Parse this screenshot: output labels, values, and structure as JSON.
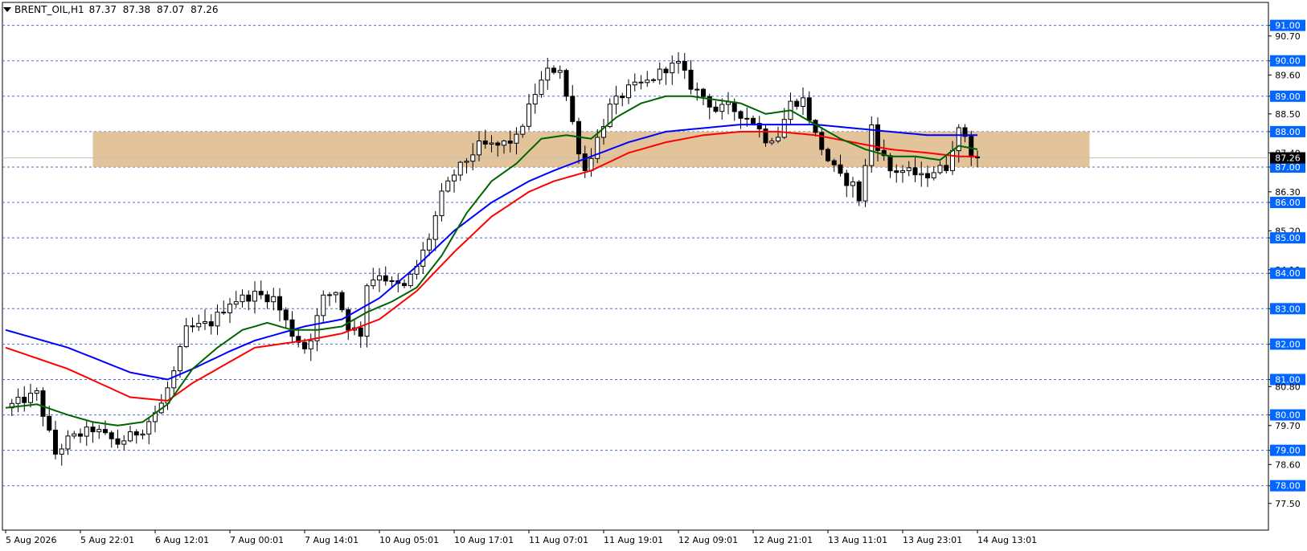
{
  "header": {
    "symbol": "BRENT_OIL,H1",
    "open": "87.37",
    "high": "87.38",
    "low": "87.07",
    "close": "87.26"
  },
  "colors": {
    "background": "#ffffff",
    "grid": "#4a6bc9",
    "zone": "#deb887",
    "ema_fast": "#006400",
    "ema_mid": "#ff0000",
    "ema_slow": "#0000ff",
    "candle": "#000000",
    "level_box": "#0066ff",
    "price_box": "#000000"
  },
  "chart_data": {
    "type": "candlestick",
    "symbol": "BRENT_OIL",
    "timeframe": "H1",
    "ylim": [
      77.2,
      91.4
    ],
    "y_ticks": [
      {
        "value": 91.0,
        "label": "91.00",
        "highlight": true
      },
      {
        "value": 90.7,
        "label": "90.70",
        "highlight": false
      },
      {
        "value": 90.0,
        "label": "90.00",
        "highlight": true
      },
      {
        "value": 89.6,
        "label": "89.60",
        "highlight": false
      },
      {
        "value": 89.0,
        "label": "89.00",
        "highlight": true
      },
      {
        "value": 88.5,
        "label": "88.50",
        "highlight": false
      },
      {
        "value": 88.0,
        "label": "88.00",
        "highlight": true
      },
      {
        "value": 87.4,
        "label": "87.40",
        "highlight": false
      },
      {
        "value": 87.0,
        "label": "87.00",
        "highlight": true
      },
      {
        "value": 86.3,
        "label": "86.30",
        "highlight": false
      },
      {
        "value": 86.0,
        "label": "86.00",
        "highlight": true
      },
      {
        "value": 85.2,
        "label": "85.20",
        "highlight": false
      },
      {
        "value": 85.0,
        "label": "85.00",
        "highlight": true
      },
      {
        "value": 84.1,
        "label": "84.10",
        "highlight": false
      },
      {
        "value": 84.0,
        "label": "84.00",
        "highlight": true
      },
      {
        "value": 83.0,
        "label": "83.00",
        "highlight": true
      },
      {
        "value": 82.0,
        "label": "82.00",
        "highlight": true
      },
      {
        "value": 81.0,
        "label": "81.00",
        "highlight": true
      },
      {
        "value": 80.8,
        "label": "80.80",
        "highlight": false
      },
      {
        "value": 80.0,
        "label": "80.00",
        "highlight": true
      },
      {
        "value": 79.7,
        "label": "79.70",
        "highlight": false
      },
      {
        "value": 79.0,
        "label": "79.00",
        "highlight": true
      },
      {
        "value": 78.6,
        "label": "78.60",
        "highlight": false
      },
      {
        "value": 78.0,
        "label": "78.00",
        "highlight": true
      },
      {
        "value": 77.5,
        "label": "77.50",
        "highlight": false
      }
    ],
    "grid_levels": [
      91,
      90,
      89,
      88,
      87,
      86,
      85,
      84,
      83,
      82,
      81,
      80,
      79,
      78
    ],
    "current_price": 87.26,
    "current_price_label": "87.26",
    "zone": {
      "from": 87.0,
      "to": 88.0,
      "start_bar": 14,
      "end_bar": 174
    },
    "x_ticks": [
      {
        "bar": 0,
        "label": "5 Aug 2026"
      },
      {
        "bar": 12,
        "label": "5 Aug 22:01"
      },
      {
        "bar": 24,
        "label": "6 Aug 12:01"
      },
      {
        "bar": 36,
        "label": "7 Aug 00:01"
      },
      {
        "bar": 48,
        "label": "7 Aug 14:01"
      },
      {
        "bar": 60,
        "label": "10 Aug 05:01"
      },
      {
        "bar": 72,
        "label": "10 Aug 17:01"
      },
      {
        "bar": 84,
        "label": "11 Aug 07:01"
      },
      {
        "bar": 96,
        "label": "11 Aug 19:01"
      },
      {
        "bar": 108,
        "label": "12 Aug 09:01"
      },
      {
        "bar": 120,
        "label": "12 Aug 21:01"
      },
      {
        "bar": 132,
        "label": "13 Aug 11:01"
      },
      {
        "bar": 144,
        "label": "13 Aug 23:01"
      },
      {
        "bar": 156,
        "label": "14 Aug 13:01"
      }
    ],
    "bar_count": 156,
    "close_anchors": [
      [
        0,
        80.2
      ],
      [
        5,
        80.6
      ],
      [
        8,
        78.9
      ],
      [
        10,
        79.3
      ],
      [
        14,
        79.6
      ],
      [
        18,
        79.2
      ],
      [
        22,
        79.6
      ],
      [
        25,
        80.3
      ],
      [
        27,
        81.2
      ],
      [
        29,
        82.4
      ],
      [
        33,
        82.6
      ],
      [
        36,
        83.2
      ],
      [
        40,
        83.4
      ],
      [
        43,
        83.3
      ],
      [
        46,
        82.3
      ],
      [
        48,
        81.9
      ],
      [
        49,
        82.2
      ],
      [
        51,
        83.3
      ],
      [
        53,
        83.5
      ],
      [
        55,
        82.5
      ],
      [
        57,
        82.3
      ],
      [
        58,
        83.7
      ],
      [
        60,
        84.0
      ],
      [
        62,
        83.7
      ],
      [
        64,
        83.6
      ],
      [
        66,
        84.2
      ],
      [
        68,
        85.0
      ],
      [
        70,
        86.2
      ],
      [
        72,
        86.8
      ],
      [
        74,
        87.2
      ],
      [
        76,
        87.6
      ],
      [
        79,
        87.6
      ],
      [
        82,
        87.8
      ],
      [
        85,
        89.1
      ],
      [
        87,
        89.7
      ],
      [
        89,
        89.8
      ],
      [
        90,
        89.0
      ],
      [
        92,
        87.5
      ],
      [
        93,
        86.9
      ],
      [
        95,
        87.8
      ],
      [
        97,
        88.7
      ],
      [
        100,
        89.2
      ],
      [
        103,
        89.4
      ],
      [
        106,
        89.8
      ],
      [
        108,
        89.9
      ],
      [
        110,
        89.3
      ],
      [
        112,
        89.0
      ],
      [
        114,
        88.6
      ],
      [
        116,
        88.7
      ],
      [
        118,
        88.5
      ],
      [
        120,
        88.3
      ],
      [
        122,
        87.8
      ],
      [
        124,
        87.9
      ],
      [
        126,
        88.8
      ],
      [
        128,
        88.9
      ],
      [
        130,
        87.9
      ],
      [
        132,
        87.2
      ],
      [
        134,
        86.7
      ],
      [
        136,
        86.5
      ],
      [
        137,
        86.1
      ],
      [
        138,
        87.0
      ],
      [
        139,
        88.2
      ],
      [
        140,
        87.6
      ],
      [
        142,
        86.9
      ],
      [
        144,
        86.9
      ],
      [
        146,
        86.8
      ],
      [
        147,
        86.7
      ],
      [
        149,
        86.9
      ],
      [
        151,
        87.0
      ],
      [
        152,
        87.6
      ],
      [
        153,
        88.0
      ],
      [
        154,
        87.9
      ],
      [
        155,
        87.37
      ],
      [
        156,
        87.26
      ]
    ],
    "ema_fast_anchors": [
      [
        0,
        80.2
      ],
      [
        5,
        80.3
      ],
      [
        10,
        80.0
      ],
      [
        14,
        79.8
      ],
      [
        18,
        79.7
      ],
      [
        22,
        79.8
      ],
      [
        26,
        80.3
      ],
      [
        30,
        81.3
      ],
      [
        34,
        81.9
      ],
      [
        38,
        82.4
      ],
      [
        42,
        82.6
      ],
      [
        46,
        82.4
      ],
      [
        50,
        82.4
      ],
      [
        54,
        82.5
      ],
      [
        58,
        82.9
      ],
      [
        62,
        83.2
      ],
      [
        66,
        83.6
      ],
      [
        70,
        84.5
      ],
      [
        74,
        85.7
      ],
      [
        78,
        86.6
      ],
      [
        82,
        87.1
      ],
      [
        86,
        87.8
      ],
      [
        90,
        87.9
      ],
      [
        94,
        87.8
      ],
      [
        98,
        88.4
      ],
      [
        102,
        88.8
      ],
      [
        106,
        89.0
      ],
      [
        110,
        89.0
      ],
      [
        114,
        88.9
      ],
      [
        118,
        88.8
      ],
      [
        122,
        88.5
      ],
      [
        126,
        88.6
      ],
      [
        130,
        88.2
      ],
      [
        134,
        87.8
      ],
      [
        138,
        87.5
      ],
      [
        142,
        87.3
      ],
      [
        146,
        87.3
      ],
      [
        150,
        87.2
      ],
      [
        153,
        87.6
      ],
      [
        156,
        87.5
      ]
    ],
    "ema_mid_anchors": [
      [
        0,
        81.9
      ],
      [
        10,
        81.3
      ],
      [
        20,
        80.5
      ],
      [
        26,
        80.4
      ],
      [
        30,
        80.9
      ],
      [
        36,
        81.5
      ],
      [
        40,
        81.9
      ],
      [
        44,
        82.0
      ],
      [
        48,
        82.1
      ],
      [
        54,
        82.3
      ],
      [
        60,
        82.7
      ],
      [
        66,
        83.5
      ],
      [
        72,
        84.6
      ],
      [
        78,
        85.6
      ],
      [
        84,
        86.3
      ],
      [
        88,
        86.6
      ],
      [
        94,
        86.9
      ],
      [
        100,
        87.4
      ],
      [
        106,
        87.7
      ],
      [
        112,
        87.9
      ],
      [
        118,
        88.0
      ],
      [
        124,
        88.0
      ],
      [
        130,
        87.9
      ],
      [
        136,
        87.7
      ],
      [
        142,
        87.5
      ],
      [
        148,
        87.4
      ],
      [
        153,
        87.3
      ],
      [
        156,
        87.3
      ]
    ],
    "ema_slow_anchors": [
      [
        0,
        82.4
      ],
      [
        10,
        81.9
      ],
      [
        20,
        81.2
      ],
      [
        26,
        81.0
      ],
      [
        30,
        81.3
      ],
      [
        36,
        81.8
      ],
      [
        40,
        82.1
      ],
      [
        44,
        82.3
      ],
      [
        48,
        82.5
      ],
      [
        54,
        82.7
      ],
      [
        60,
        83.3
      ],
      [
        66,
        84.2
      ],
      [
        72,
        85.2
      ],
      [
        78,
        86.0
      ],
      [
        84,
        86.6
      ],
      [
        88,
        86.9
      ],
      [
        94,
        87.3
      ],
      [
        100,
        87.7
      ],
      [
        106,
        88.0
      ],
      [
        112,
        88.1
      ],
      [
        118,
        88.2
      ],
      [
        124,
        88.2
      ],
      [
        130,
        88.2
      ],
      [
        136,
        88.1
      ],
      [
        142,
        88.0
      ],
      [
        148,
        87.9
      ],
      [
        153,
        87.9
      ],
      [
        156,
        87.9
      ]
    ]
  }
}
